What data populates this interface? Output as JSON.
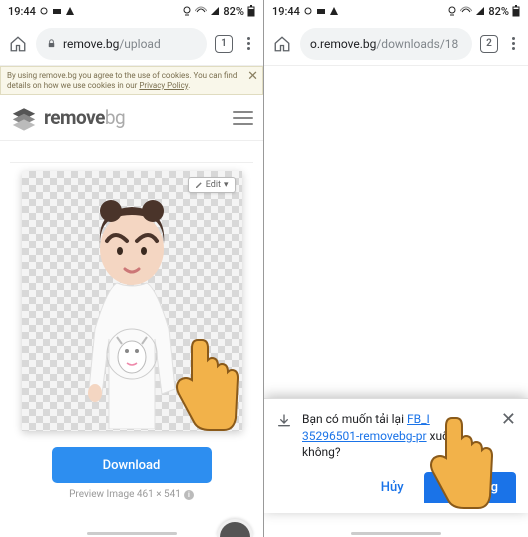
{
  "status": {
    "time": "19:44",
    "battery": "82%"
  },
  "left": {
    "url_host": "remove.bg",
    "url_path": "/upload",
    "tabs": "1",
    "cookie": "By using remove.bg you agree to the use of cookies. You can find details on how we use cookies in our ",
    "cookie_link": "Privacy Policy",
    "logo_a": "remove",
    "logo_b": "bg",
    "edit": "Edit",
    "download": "Download",
    "preview": "Preview Image 461 × 541"
  },
  "right": {
    "url_host": "o.remove.bg",
    "url_path": "/downloads/18",
    "tabs": "2",
    "sheet_pre": "Bạn có muốn tải lại ",
    "sheet_file1": "FB_I",
    "sheet_file2": "35296501-removebg-pr",
    "sheet_post": " xuống không?",
    "cancel": "Hủy",
    "ok": "Tải xuống"
  }
}
